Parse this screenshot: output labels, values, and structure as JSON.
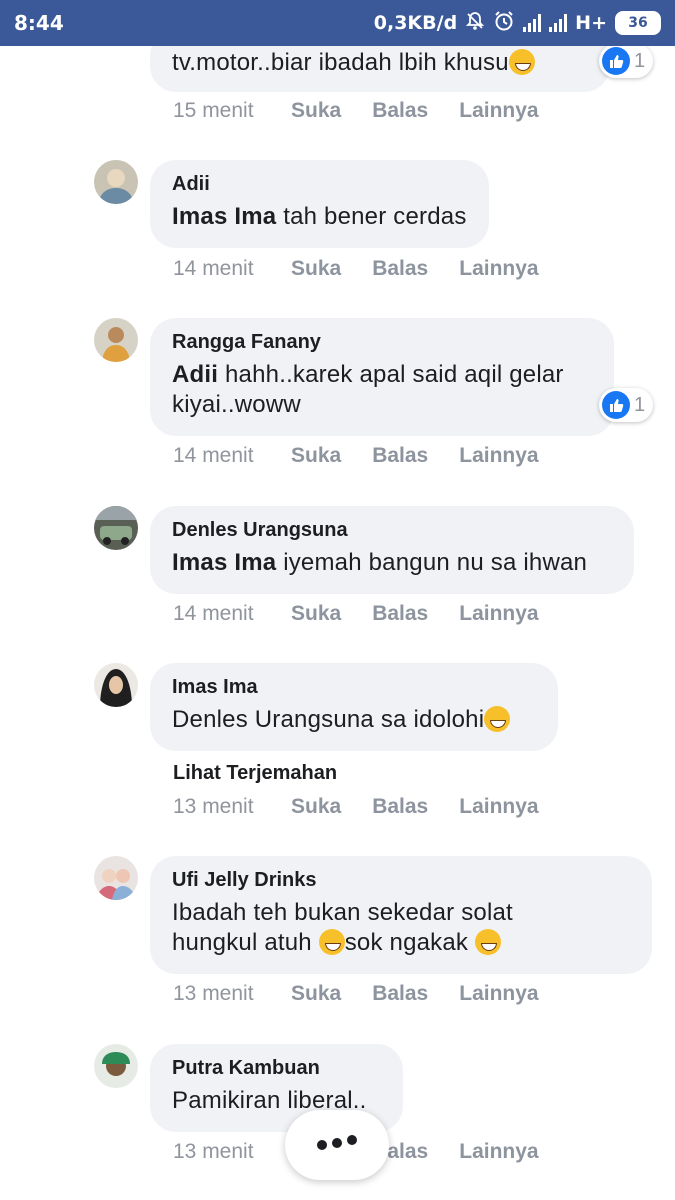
{
  "status_bar": {
    "time": "8:44",
    "data_rate": "0,3KB/d",
    "network": "H+",
    "battery": "36",
    "icons": [
      "notification-muted-icon",
      "alarm-icon",
      "signal-icon",
      "signal-icon",
      "battery-icon"
    ]
  },
  "colors": {
    "status_bar_bg": "#3b5998",
    "bubble_bg": "#f0f2f5",
    "like_blue": "#1877f2",
    "meta_gray": "#8d949e"
  },
  "actions": {
    "like": "Suka",
    "reply": "Balas",
    "more": "Lainnya"
  },
  "comments": [
    {
      "author": "",
      "mention": "",
      "text": "tv.motor..biar ibadah lbih khusu",
      "emoji": [
        "grinning-face-emoji"
      ],
      "time": "15 menit",
      "reactions": "1"
    },
    {
      "author": "Adii",
      "mention": "Imas Ima",
      "text": " tah bener cerdas",
      "time": "14 menit"
    },
    {
      "author": "Rangga Fanany",
      "mention": "Adii",
      "text": " hahh..karek apal said aqil gelar kiyai..woww",
      "time": "14 menit",
      "reactions": "1"
    },
    {
      "author": "Denles Urangsuna",
      "mention": "Imas Ima",
      "text": " iyemah bangun nu sa ihwan",
      "time": "14 menit"
    },
    {
      "author": "Imas Ima",
      "mention": "",
      "text": "Denles Urangsuna sa idolohi",
      "emoji": [
        "sweat-smile-emoji"
      ],
      "time": "13 menit",
      "translate": "Lihat Terjemahan"
    },
    {
      "author": "Ufi Jelly Drinks",
      "mention": "",
      "text_line1": "Ibadah teh bukan sekedar solat",
      "text_line2a": "hungkul atuh ",
      "text_line2b": "sok ngakak ",
      "emoji": [
        "joy-emoji",
        "joy-emoji"
      ],
      "time": "13 menit"
    },
    {
      "author": "Putra Kambuan",
      "mention": "",
      "text": "Pamikiran liberal..",
      "time": "13 menit"
    }
  ],
  "more_button_icon": "more-dots-icon"
}
